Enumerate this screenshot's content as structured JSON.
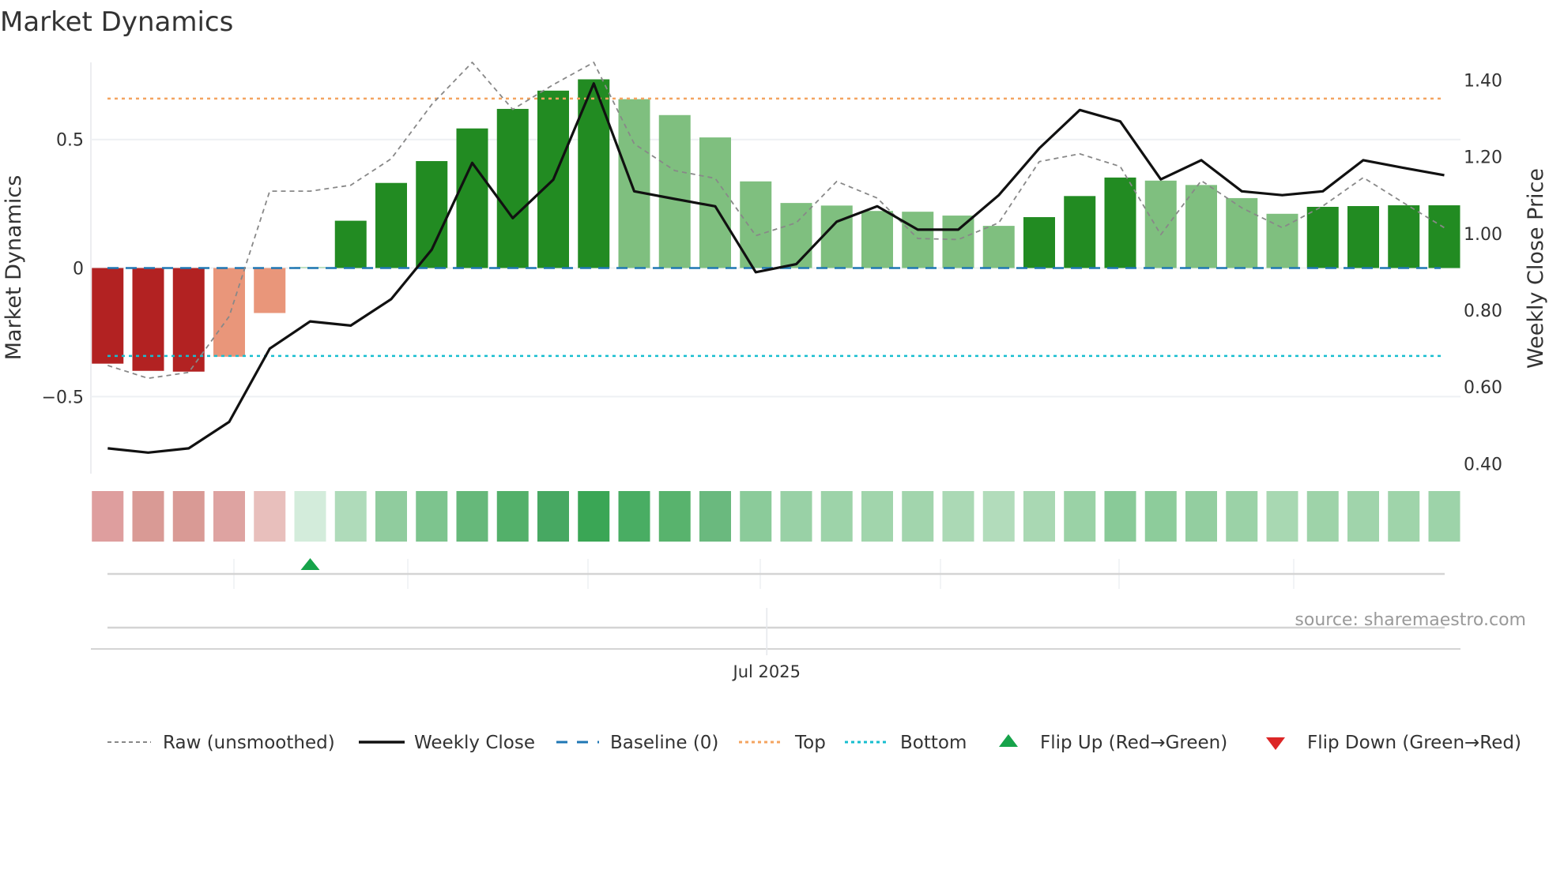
{
  "chart_data": {
    "type": "bar",
    "title": "Market Dynamics",
    "ylabel": "Market Dynamics",
    "y2label": "Weekly Close Price",
    "ylim": [
      -0.8,
      0.8
    ],
    "y2lim": [
      0.374,
      1.446
    ],
    "yticks": [
      {
        "value": 0.5,
        "label": "0.5"
      },
      {
        "value": 0,
        "label": "0"
      },
      {
        "value": -0.5,
        "label": "−0.5"
      }
    ],
    "y2ticks": [
      {
        "value": 1.4,
        "label": "1.40"
      },
      {
        "value": 1.2,
        "label": "1.20"
      },
      {
        "value": 1.0,
        "label": "1.00"
      },
      {
        "value": 0.8,
        "label": "0.80"
      },
      {
        "value": 0.6,
        "label": "0.60"
      },
      {
        "value": 0.4,
        "label": "0.40"
      }
    ],
    "xticks": [
      {
        "index": 16,
        "label": "Jul 2025"
      }
    ],
    "grid": true,
    "bars": {
      "values": [
        -0.372,
        -0.4,
        -0.403,
        -0.345,
        -0.175,
        0.004,
        0.184,
        0.331,
        0.416,
        0.543,
        0.619,
        0.69,
        0.734,
        0.657,
        0.595,
        0.508,
        0.337,
        0.253,
        0.243,
        0.222,
        0.219,
        0.204,
        0.164,
        0.198,
        0.28,
        0.352,
        0.34,
        0.323,
        0.272,
        0.211,
        0.238,
        0.241,
        0.244,
        0.244
      ],
      "colors": [
        "#b22222",
        "#b22222",
        "#b22222",
        "#e9967a",
        "#e9967a",
        "#a8d8a8",
        "#228b22",
        "#228b22",
        "#228b22",
        "#228b22",
        "#228b22",
        "#228b22",
        "#228b22",
        "#7fbf7f",
        "#7fbf7f",
        "#7fbf7f",
        "#7fbf7f",
        "#7fbf7f",
        "#7fbf7f",
        "#7fbf7f",
        "#7fbf7f",
        "#7fbf7f",
        "#7fbf7f",
        "#228b22",
        "#228b22",
        "#228b22",
        "#7fbf7f",
        "#7fbf7f",
        "#7fbf7f",
        "#7fbf7f",
        "#228b22",
        "#228b22",
        "#228b22",
        "#228b22"
      ]
    },
    "series": [
      {
        "name": "Raw (unsmoothed)",
        "axis": "left",
        "color": "#888888",
        "values": [
          -0.379,
          -0.429,
          -0.406,
          -0.188,
          0.299,
          0.299,
          0.322,
          0.425,
          0.636,
          0.8,
          0.617,
          0.713,
          0.8,
          0.483,
          0.379,
          0.349,
          0.126,
          0.176,
          0.337,
          0.272,
          0.115,
          0.111,
          0.176,
          0.414,
          0.444,
          0.395,
          0.13,
          0.34,
          0.234,
          0.157,
          0.241,
          0.352,
          0.253,
          0.157
        ]
      },
      {
        "name": "Weekly Close",
        "axis": "right",
        "color": "#111111",
        "values": [
          0.44,
          0.429,
          0.44,
          0.509,
          0.7,
          0.771,
          0.76,
          0.829,
          0.958,
          1.184,
          1.04,
          1.14,
          1.391,
          1.11,
          1.09,
          1.071,
          0.899,
          0.92,
          1.031,
          1.071,
          1.01,
          1.01,
          1.1,
          1.222,
          1.322,
          1.292,
          1.141,
          1.191,
          1.11,
          1.1,
          1.11,
          1.191,
          1.171,
          1.152
        ]
      }
    ],
    "reference_lines": [
      {
        "name": "Baseline (0)",
        "value": 0,
        "color": "#1f77b4",
        "style": "dashed"
      },
      {
        "name": "Top",
        "value": 0.659,
        "color": "#f4a460",
        "style": "dotted"
      },
      {
        "name": "Bottom",
        "value": -0.342,
        "color": "#17becf",
        "style": "dotted"
      }
    ],
    "heatmap_colors": [
      "#de9e9e",
      "#d99a95",
      "#d99a95",
      "#dea3a1",
      "#e8bfbc",
      "#d3ecdb",
      "#afdbba",
      "#90cc9e",
      "#7dc48e",
      "#66b87a",
      "#53b06a",
      "#47a862",
      "#3aa655",
      "#49ad63",
      "#58b36d",
      "#6ab97e",
      "#8bcb9a",
      "#99d1a6",
      "#9dd3a9",
      "#a1d5ac",
      "#a2d5ad",
      "#abd9b5",
      "#b2dcbb",
      "#a9d8b3",
      "#9ad2a6",
      "#89ca98",
      "#8dcc9b",
      "#93cea0",
      "#9bd2a7",
      "#a8d8b2",
      "#9ed3a9",
      "#a0d4ab",
      "#9fd4aa",
      "#9dd3a9"
    ],
    "flips": [
      {
        "index": 5,
        "type": "up"
      }
    ],
    "legend": {
      "placement": "bottom",
      "items": [
        {
          "label": "Raw (unsmoothed)",
          "kind": "dotted-gray"
        },
        {
          "label": "Weekly Close",
          "kind": "solid-black"
        },
        {
          "label": "Baseline (0)",
          "kind": "dashed-blue"
        },
        {
          "label": "Top",
          "kind": "dotted-orange"
        },
        {
          "label": "Bottom",
          "kind": "dotted-cyan"
        },
        {
          "label": "Flip Up (Red→Green)",
          "kind": "triangle-up",
          "color": "#16a34a"
        },
        {
          "label": "Flip Down (Green→Red)",
          "kind": "triangle-down",
          "color": "#dc2626"
        }
      ]
    },
    "source": "source: sharemaestro.com"
  }
}
